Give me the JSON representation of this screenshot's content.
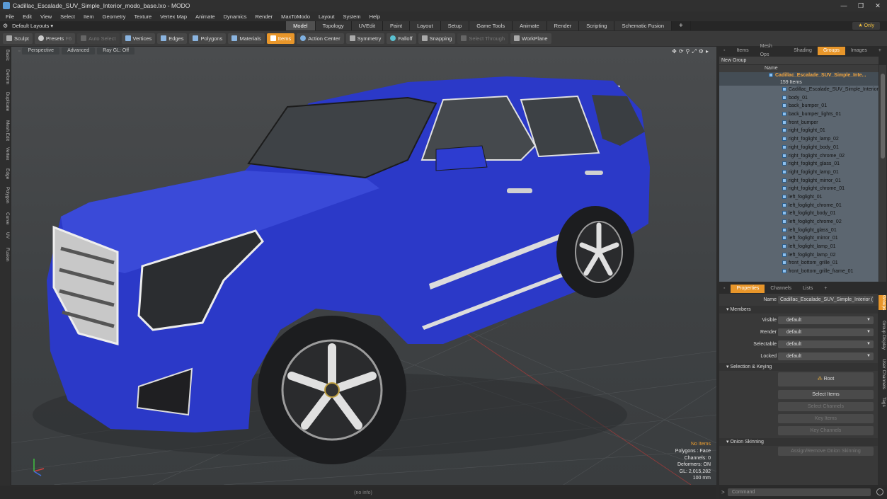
{
  "window": {
    "title": "Cadillac_Escalade_SUV_Simple_Interior_modo_base.lxo - MODO"
  },
  "menu": [
    "File",
    "Edit",
    "View",
    "Select",
    "Item",
    "Geometry",
    "Texture",
    "Vertex Map",
    "Animate",
    "Dynamics",
    "Render",
    "MaxToModo",
    "Layout",
    "System",
    "Help"
  ],
  "layouts": {
    "selector": "Default Layouts",
    "tabs": [
      "Model",
      "Topology",
      "UVEdit",
      "Paint",
      "Layout",
      "Setup",
      "Game Tools",
      "Animate",
      "Render",
      "Scripting",
      "Schematic Fusion"
    ],
    "active": "Model",
    "only": "Only"
  },
  "toolbar": {
    "sculpt": "Sculpt",
    "presets": "Presets",
    "auto_select": "Auto Select",
    "vertices": "Vertices",
    "edges": "Edges",
    "polygons": "Polygons",
    "materials": "Materials",
    "items": "Items",
    "action_center": "Action Center",
    "symmetry": "Symmetry",
    "falloff": "Falloff",
    "snapping": "Snapping",
    "select_through": "Select Through",
    "workplane": "WorkPlane",
    "presets_key": "F6"
  },
  "lefttabs": [
    "Basic",
    "Deform",
    "Duplicate",
    "Mesh Edit",
    "Vertex",
    "Edge",
    "Polygon",
    "Curve",
    "UV",
    "Fusion"
  ],
  "viewport": {
    "mode": "Perspective",
    "shading": "Advanced",
    "ray": "Ray GL: Off",
    "stats": {
      "items": "No Items",
      "polygons": "Polygons : Face",
      "channels": "Channels: 0",
      "deformers": "Deformers: ON",
      "gl": "GL: 2,015,282",
      "size": "100 mm"
    }
  },
  "status": {
    "info": "(no info)"
  },
  "right_tabs": [
    "Items",
    "Mesh Ops",
    "Shading",
    "Groups",
    "Images"
  ],
  "right_active": "Groups",
  "groups": {
    "new_group": "New Group",
    "col_name": "Name",
    "root": "Cadillac_Escalade_SUV_Simple_Inte...",
    "count": "159 Items",
    "items": [
      "Cadillac_Escalade_SUV_Simple_Interior",
      "body_01",
      "back_bumper_01",
      "back_bumper_lights_01",
      "front_bumper",
      "right_foglight_01",
      "right_foglight_lamp_02",
      "right_foglight_body_01",
      "right_foglight_chrome_02",
      "right_foglight_glass_01",
      "right_foglight_lamp_01",
      "right_foglight_mirror_01",
      "right_foglight_chrome_01",
      "left_foglight_01",
      "left_foglight_chrome_01",
      "left_foglight_body_01",
      "left_foglight_chrome_02",
      "left_foglight_glass_01",
      "left_foglight_mirror_01",
      "left_foglight_lamp_01",
      "left_foglight_lamp_02",
      "front_bottom_grille_01",
      "front_bottom_grille_frame_01"
    ]
  },
  "props_tabs": [
    "Properties",
    "Channels",
    "Lists"
  ],
  "properties": {
    "name_label": "Name",
    "name_value": "Cadillac_Escalade_SUV_Simple_Interior (",
    "members": "Members",
    "visible": "Visible",
    "render": "Render",
    "selectable": "Selectable",
    "locked": "Locked",
    "default": "default",
    "sel_keying": "Selection & Keying",
    "root": "Root",
    "select_items": "Select Items",
    "select_channels": "Select Channels",
    "key_items": "Key Items",
    "key_channels": "Key Channels",
    "onion": "Onion Skinning",
    "onion_btn": "Assign/Remove Onion Skinning"
  },
  "right_vtabs": [
    "Groups",
    "Group Display",
    "User Channels",
    "Tags"
  ],
  "command": {
    "placeholder": "Command"
  }
}
